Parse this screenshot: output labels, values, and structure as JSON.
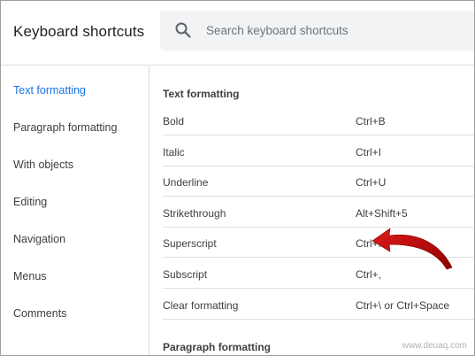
{
  "header": {
    "title": "Keyboard shortcuts",
    "search": {
      "placeholder": "Search keyboard shortcuts",
      "value": "",
      "icon": "search-icon"
    }
  },
  "sidebar": {
    "items": [
      {
        "label": "Text formatting",
        "active": true
      },
      {
        "label": "Paragraph formatting",
        "active": false
      },
      {
        "label": "With objects",
        "active": false
      },
      {
        "label": "Editing",
        "active": false
      },
      {
        "label": "Navigation",
        "active": false
      },
      {
        "label": "Menus",
        "active": false
      },
      {
        "label": "Comments",
        "active": false
      }
    ]
  },
  "main": {
    "sections": [
      {
        "title": "Text formatting",
        "shortcuts": [
          {
            "name": "Bold",
            "keys": "Ctrl+B"
          },
          {
            "name": "Italic",
            "keys": "Ctrl+I"
          },
          {
            "name": "Underline",
            "keys": "Ctrl+U"
          },
          {
            "name": "Strikethrough",
            "keys": "Alt+Shift+5"
          },
          {
            "name": "Superscript",
            "keys": "Ctrl+."
          },
          {
            "name": "Subscript",
            "keys": "Ctrl+,"
          },
          {
            "name": "Clear formatting",
            "keys": "Ctrl+\\ or Ctrl+Space"
          }
        ]
      },
      {
        "title": "Paragraph formatting"
      }
    ]
  },
  "annotation": {
    "type": "red-arrow",
    "color": "#c00000",
    "points_to": "Superscript"
  },
  "watermark": "www.deuaq.com",
  "colors": {
    "accent": "#1a73e8",
    "search_bg": "#f1f3f4",
    "divider": "#e0e0e0"
  }
}
